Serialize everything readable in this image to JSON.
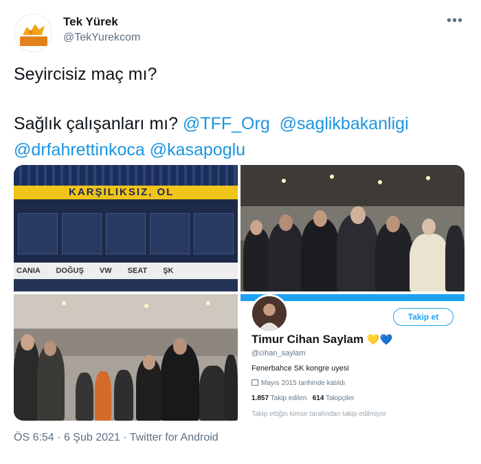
{
  "author": {
    "name": "Tek Yürek",
    "handle": "@TekYurekcom",
    "avatar_text": "TEK YÜREK",
    "more_label": "•••"
  },
  "tweet": {
    "line1": "Seyircisiz maç mı?",
    "line2_prefix": "Sağlık çalışanları mı?",
    "mentions": [
      "@TFF_Org",
      "@saglikbakanligi",
      "@drfahrettinkoca",
      "@kasapoglu"
    ]
  },
  "media": {
    "stadium_banner": "KARŞILIKSIZ, OL",
    "stadium_sponsors": "CANIA DOĞUŞ VW SEAT ŞK",
    "profile_card": {
      "follow_label": "Takip et",
      "name": "Timur Cihan Saylam",
      "hearts": [
        "💛",
        "💙"
      ],
      "handle": "@cihan_saylam",
      "bio": "Fenerbahce SK kongre uyesi",
      "joined": "Mayıs 2015 tarihinde katıldı",
      "following_count": "1.857",
      "following_label": "Takip edilen",
      "followers_count": "614",
      "followers_label": "Takipçiler",
      "cut_text": "Takip ettiğin kimse tarafından takip edilmiyor"
    }
  },
  "footer": {
    "time": "ÖS 6:54",
    "separator": "·",
    "date": "6 Şub 2021",
    "app": "Twitter for Android"
  }
}
